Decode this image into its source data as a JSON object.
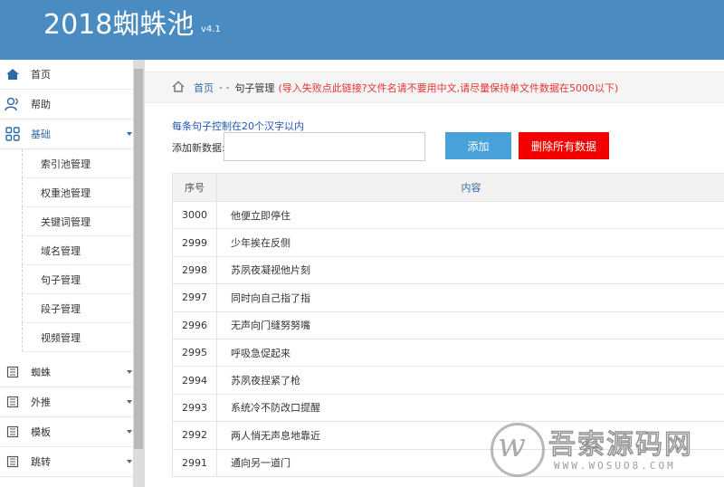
{
  "header": {
    "brand": "2018蜘蛛池",
    "version": "v4.1"
  },
  "sidebar": {
    "items": [
      {
        "label": "首页",
        "icon": "home-icon"
      },
      {
        "label": "帮助",
        "icon": "users-icon"
      },
      {
        "label": "基础",
        "icon": "grid-icon"
      }
    ],
    "sub_items": [
      "索引池管理",
      "权重池管理",
      "关键词管理",
      "域名管理",
      "句子管理",
      "段子管理",
      "视频管理"
    ],
    "lower_items": [
      {
        "label": "蜘蛛",
        "icon": "book-icon"
      },
      {
        "label": "外推",
        "icon": "book-icon"
      },
      {
        "label": "模板",
        "icon": "book-icon"
      },
      {
        "label": "跳转",
        "icon": "book-icon"
      }
    ]
  },
  "breadcrumb": {
    "home": "首页",
    "sep": "- -",
    "current": "句子管理",
    "note": "(导入失败点此链接?文件名请不要用中文,请尽量保持单文件数据在5000以下)"
  },
  "form": {
    "hint": "每条句子控制在20个汉字以内",
    "label": "添加新数据:",
    "input_value": "",
    "add_button": "添加",
    "delete_button": "删除所有数据"
  },
  "table": {
    "headers": [
      "序号",
      "内容"
    ],
    "rows": [
      [
        "3000",
        "他便立即停住"
      ],
      [
        "2999",
        "少年挨在反侧"
      ],
      [
        "2998",
        "苏夙夜凝视他片刻"
      ],
      [
        "2997",
        "同时向自己指了指"
      ],
      [
        "2996",
        "无声向门缝努努嘴"
      ],
      [
        "2995",
        "呼吸急促起来"
      ],
      [
        "2994",
        "苏夙夜捏紧了枪"
      ],
      [
        "2993",
        "系统冷不防改口提醒"
      ],
      [
        "2992",
        "两人悄无声息地靠近"
      ],
      [
        "2991",
        "通向另一道门"
      ]
    ]
  },
  "watermark": {
    "title": "吾索源码网",
    "url": "WWW.WOSUO8.COM"
  },
  "colors": {
    "topbar": "#4a8bc2",
    "add_button": "#48a1d9",
    "delete_button": "#f40000",
    "note": "#e53333",
    "link": "#2d6ba8"
  }
}
